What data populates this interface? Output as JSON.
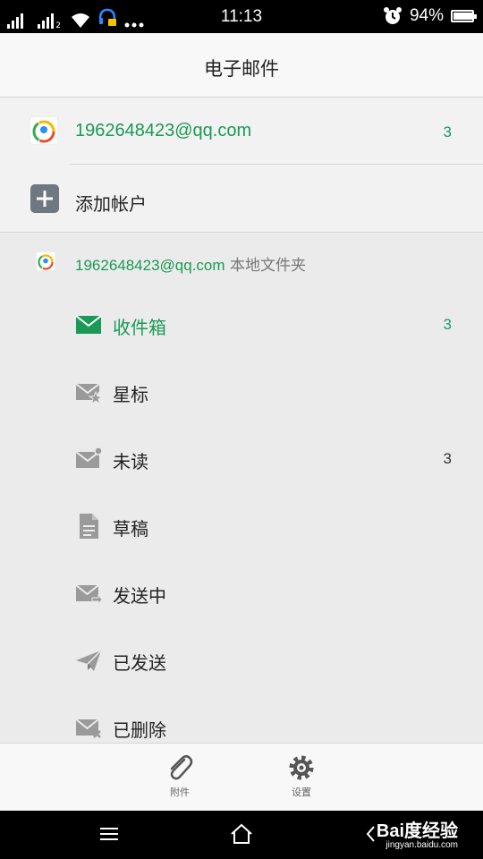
{
  "status_bar": {
    "time": "11:13",
    "battery": "94%",
    "sim2_label": "2"
  },
  "header": {
    "title": "电子邮件"
  },
  "account": {
    "email": "1962648423@qq.com",
    "unread_count": "3"
  },
  "add_account": {
    "label": "添加帐户"
  },
  "folder_header": {
    "email": "1962648423@qq.com",
    "suffix": " 本地文件夹"
  },
  "folders": [
    {
      "label": "收件箱",
      "count": "3",
      "icon": "inbox-icon"
    },
    {
      "label": "星标",
      "count": "",
      "icon": "star-mail-icon"
    },
    {
      "label": "未读",
      "count": "3",
      "icon": "unread-mail-icon"
    },
    {
      "label": "草稿",
      "count": "",
      "icon": "draft-icon"
    },
    {
      "label": "发送中",
      "count": "",
      "icon": "outbox-icon"
    },
    {
      "label": "已发送",
      "count": "",
      "icon": "sent-icon"
    },
    {
      "label": "已删除",
      "count": "",
      "icon": "trash-mail-icon"
    }
  ],
  "bottom_bar": {
    "attachments_label": "附件",
    "settings_label": "设置"
  },
  "watermark": {
    "brand": "Bai度经验",
    "url": "jingyan.baidu.com"
  },
  "colors": {
    "accent": "#1a9a56",
    "icon_gray": "#9a9a9a"
  }
}
